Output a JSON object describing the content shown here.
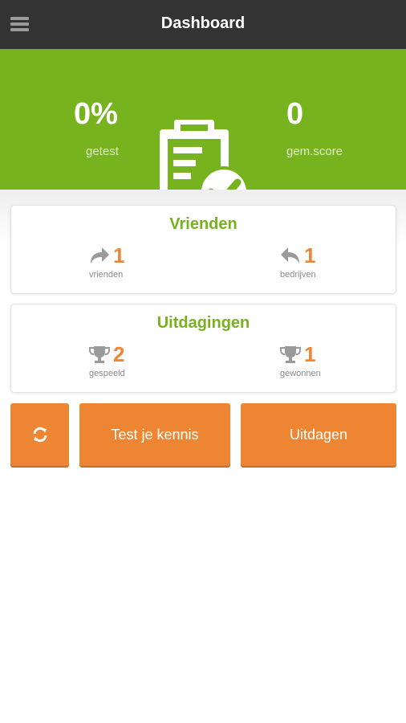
{
  "header": {
    "title": "Dashboard",
    "menu_icon": "hamburger-menu-icon"
  },
  "hero": {
    "tested_value": "0%",
    "tested_label": "getest",
    "score_value": "0",
    "score_label": "gem.score",
    "icon": "clipboard-check-icon"
  },
  "friends": {
    "title": "Vrienden",
    "left": {
      "icon": "share-arrow-icon",
      "value": "1",
      "label": "vrienden"
    },
    "right": {
      "icon": "reply-arrow-icon",
      "value": "1",
      "label": "bedrijven"
    }
  },
  "challenges": {
    "title": "Uitdagingen",
    "left": {
      "icon": "trophy-icon",
      "value": "2",
      "label": "gespeeld"
    },
    "right": {
      "icon": "trophy-icon",
      "value": "1",
      "label": "gewonnen"
    }
  },
  "actions": {
    "refresh_icon": "refresh-icon",
    "test_label": "Test je kennis",
    "challenge_label": "Uitdagen"
  },
  "colors": {
    "topbar": "#333333",
    "hero_green": "#77b31f",
    "title_green": "#76b21e",
    "accent_orange": "#ee8532",
    "icon_gray": "#9a9a9a"
  }
}
